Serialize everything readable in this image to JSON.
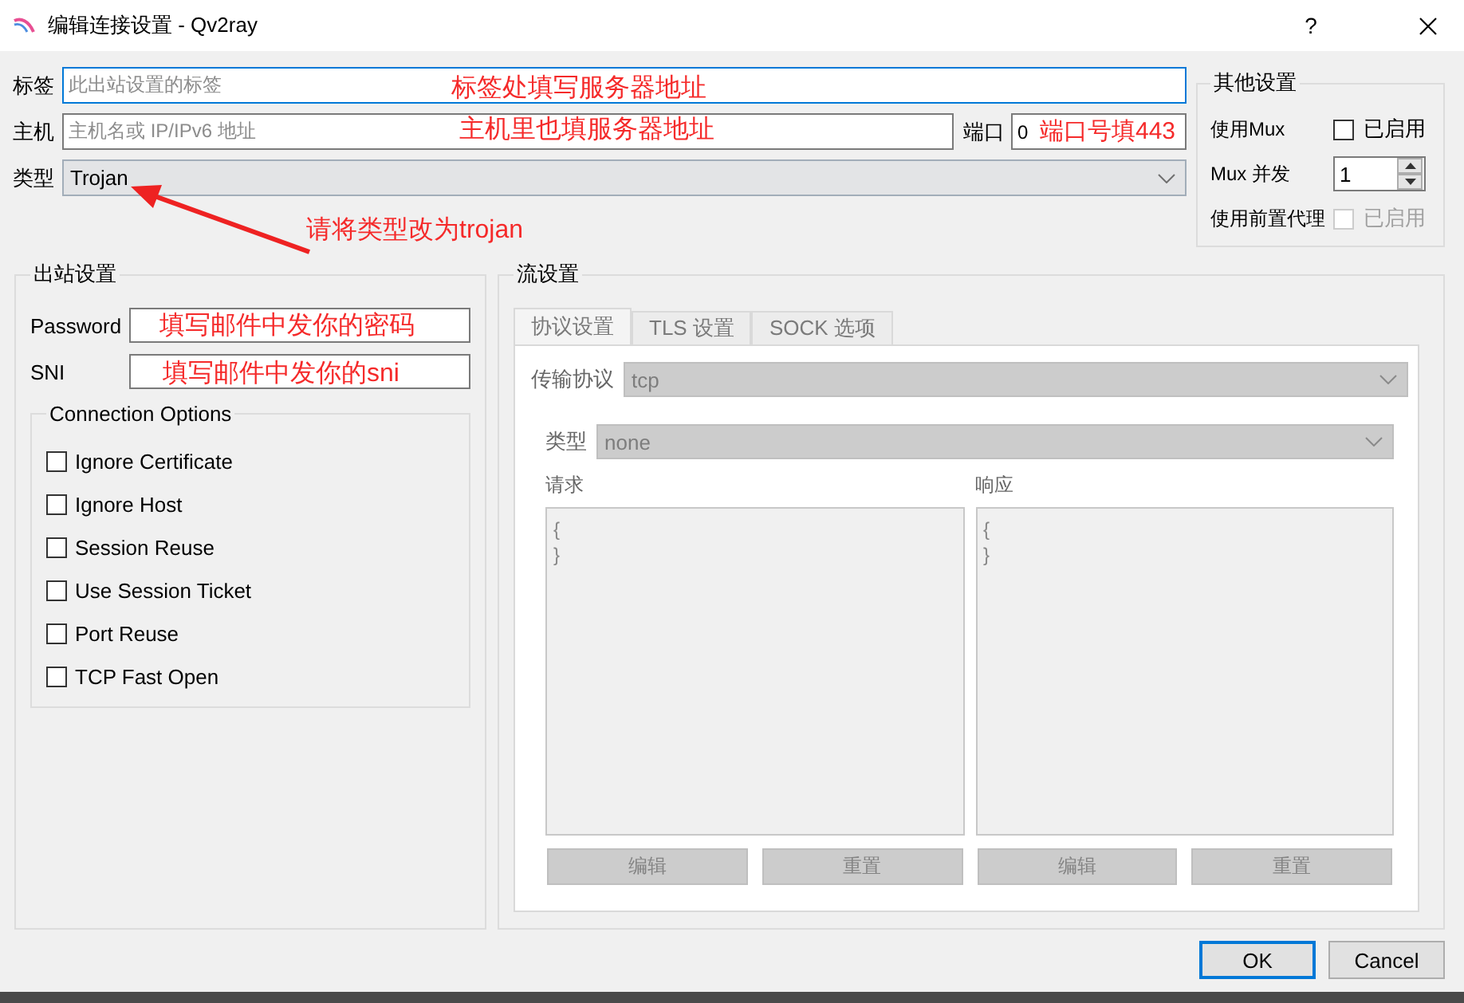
{
  "window": {
    "title": "编辑连接设置 - Qv2ray",
    "help": "?"
  },
  "connection": {
    "tag": {
      "label": "标签",
      "placeholder": "此出站设置的标签",
      "focused": true,
      "annotation": "标签处填写服务器地址"
    },
    "host": {
      "label": "主机",
      "placeholder": "主机名或 IP/IPv6 地址",
      "focused": false,
      "annotation": "主机里也填服务器地址"
    },
    "port": {
      "label": "端口",
      "value": "0",
      "annotation": "端口号填443"
    },
    "type": {
      "label": "类型",
      "value": "Trojan",
      "annotation": "请将类型改为trojan"
    }
  },
  "other_settings": {
    "title": "其他设置",
    "rows": [
      {
        "kind": "checkbox",
        "label": "使用Mux",
        "option": "已启用",
        "checked": false,
        "disabled": false
      },
      {
        "kind": "spinbox",
        "label": "Mux 并发",
        "value": "1"
      },
      {
        "kind": "checkbox",
        "label": "使用前置代理",
        "option": "已启用",
        "checked": false,
        "disabled": true
      }
    ]
  },
  "outbound_settings": {
    "title": "出站设置",
    "fields": [
      {
        "label": "Password",
        "annotation": "填写邮件中发你的密码"
      },
      {
        "label": "SNI",
        "annotation": "填写邮件中发你的sni"
      }
    ],
    "connection_options": {
      "title": "Connection Options",
      "options": [
        {
          "label": "Ignore Certificate",
          "checked": false
        },
        {
          "label": "Ignore Host",
          "checked": false
        },
        {
          "label": "Session Reuse",
          "checked": false
        },
        {
          "label": "Use Session Ticket",
          "checked": false
        },
        {
          "label": "Port Reuse",
          "checked": false
        },
        {
          "label": "TCP Fast Open",
          "checked": false
        }
      ]
    }
  },
  "stream_settings": {
    "title": "流设置",
    "disabled": true,
    "tabs": [
      {
        "label": "协议设置",
        "selected": true
      },
      {
        "label": "TLS 设置",
        "selected": false
      },
      {
        "label": "SOCK 选项",
        "selected": false
      }
    ],
    "transport": {
      "label": "传输协议",
      "value": "tcp"
    },
    "header_type": {
      "label": "类型",
      "value": "none"
    },
    "editors": [
      {
        "label": "请求",
        "content": "{\n}",
        "buttons": [
          "编辑",
          "重置"
        ]
      },
      {
        "label": "响应",
        "content": "{\n}",
        "buttons": [
          "编辑",
          "重置"
        ]
      }
    ]
  },
  "buttons": [
    {
      "label": "OK",
      "default": true
    },
    {
      "label": "Cancel",
      "default": false
    }
  ]
}
